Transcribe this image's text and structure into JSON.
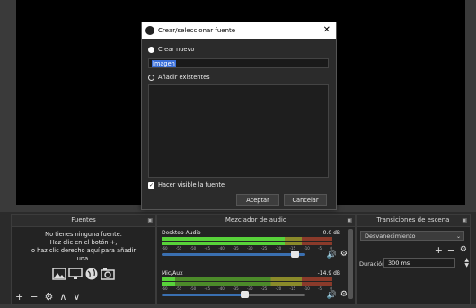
{
  "dialog": {
    "title": "Crear/seleccionar fuente",
    "create_new_label": "Crear nuevo",
    "name_value": "Imagen",
    "existing_label": "Añadir existentes",
    "make_visible_label": "Hacer visible la fuente",
    "accept_label": "Aceptar",
    "cancel_label": "Cancelar"
  },
  "sources": {
    "title": "Fuentes",
    "empty_line1": "No tienes ninguna fuente.",
    "empty_line2": "Haz clic en el botón +,",
    "empty_line3": "o haz clic derecho aquí para añadir",
    "empty_line4": "una.",
    "icons": [
      "image-icon",
      "monitor-icon",
      "globe-icon",
      "camera-icon"
    ]
  },
  "mixer": {
    "title": "Mezclador de audio",
    "tracks": [
      {
        "name": "Desktop Audio",
        "db": "0.0 dB",
        "level": 0.72,
        "volume": 0.93
      },
      {
        "name": "Mic/Aux",
        "db": "-14.9 dB",
        "level": 0.08,
        "volume": 0.58
      }
    ],
    "scale": [
      "-60",
      "-55",
      "-50",
      "-45",
      "-40",
      "-35",
      "-30",
      "-25",
      "-20",
      "-15",
      "-10",
      "-5",
      "0"
    ]
  },
  "transitions": {
    "title": "Transiciones de escena",
    "selected": "Desvanecimiento",
    "duration_label": "Duración",
    "duration_value": "300 ms"
  },
  "colors": {
    "accent": "#3a6fd8",
    "meter_green": "#58d23a"
  }
}
